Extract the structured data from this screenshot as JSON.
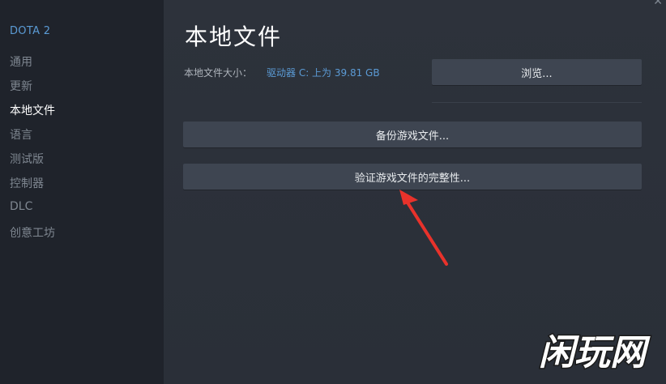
{
  "sidebar": {
    "game_title": "DOTA 2",
    "items": [
      {
        "label": "通用"
      },
      {
        "label": "更新"
      },
      {
        "label": "本地文件"
      },
      {
        "label": "语言"
      },
      {
        "label": "测试版"
      },
      {
        "label": "控制器"
      },
      {
        "label": "DLC"
      },
      {
        "label": "创意工坊"
      }
    ],
    "active_index": 2
  },
  "main": {
    "title": "本地文件",
    "size_label": "本地文件大小：",
    "size_value": "驱动器 C: 上为 39.81 GB",
    "browse_label": "浏览...",
    "backup_label": "备份游戏文件...",
    "verify_label": "验证游戏文件的完整性..."
  },
  "watermark": {
    "text": "闲玩网"
  },
  "colors": {
    "accent": "#5b9bd5",
    "arrow": "#e8322b",
    "sidebar_bg": "#1f232b",
    "main_bg": "#2a2f38",
    "button_bg": "#3e4551"
  },
  "icons": {
    "close": "close-icon",
    "annotation": "red-arrow-annotation"
  }
}
